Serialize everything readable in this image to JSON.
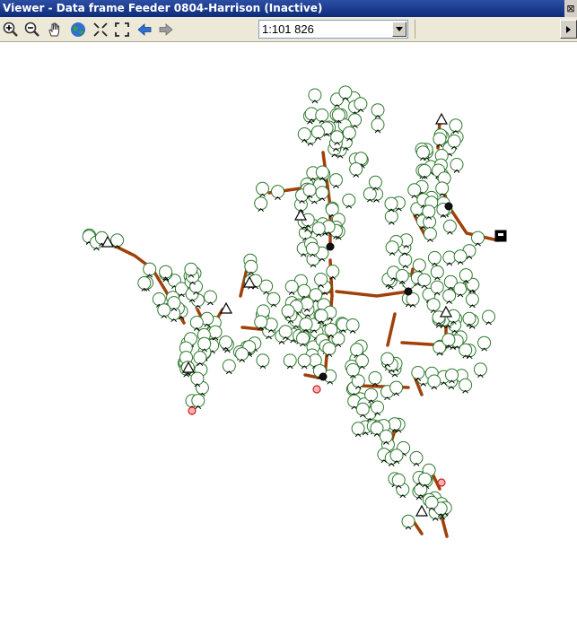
{
  "window": {
    "title": "Viewer - Data frame Feeder 0804-Harrison (Inactive)",
    "close_glyph": "⊠"
  },
  "toolbar": {
    "tools": [
      "zoom-in-icon",
      "zoom-out-icon",
      "pan-hand-icon",
      "full-extent-globe-icon",
      "fixed-zoom-in-icon",
      "fixed-zoom-out-icon",
      "back-arrow-icon",
      "forward-arrow-icon"
    ],
    "scale_value": "1:101 826"
  },
  "map": {
    "colors": {
      "symbol_stroke": "#2f7a2f",
      "line": "#a0400a",
      "triangle": "#000000",
      "red_marker": "#d02020"
    }
  }
}
